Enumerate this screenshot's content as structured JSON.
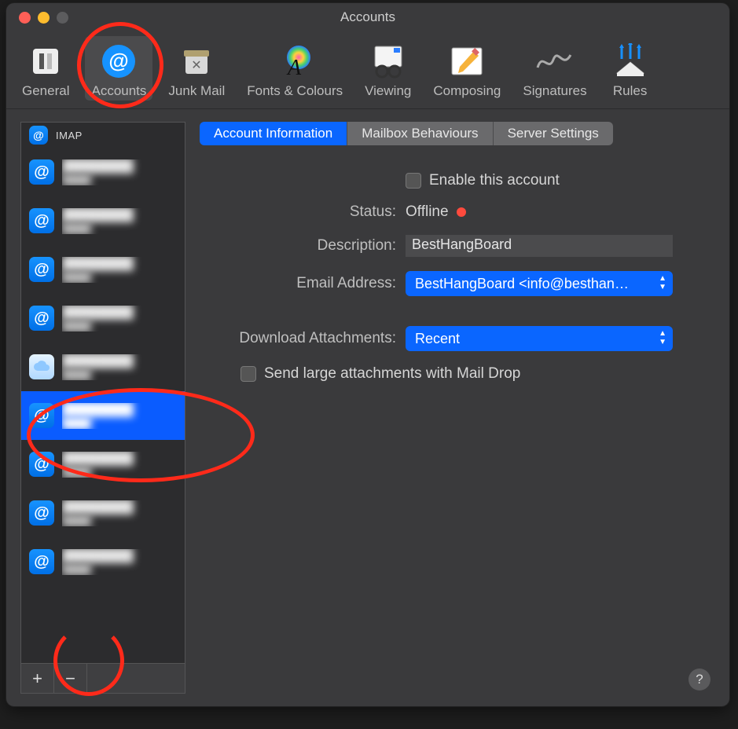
{
  "window": {
    "title": "Accounts"
  },
  "toolbar": {
    "items": [
      {
        "label": "General"
      },
      {
        "label": "Accounts"
      },
      {
        "label": "Junk Mail"
      },
      {
        "label": "Fonts & Colours"
      },
      {
        "label": "Viewing"
      },
      {
        "label": "Composing"
      },
      {
        "label": "Signatures"
      },
      {
        "label": "Rules"
      }
    ],
    "selected_index": 1
  },
  "sidebar": {
    "header_label": "IMAP",
    "add_label": "+",
    "remove_label": "−"
  },
  "tabs": {
    "items": [
      {
        "label": "Account Information"
      },
      {
        "label": "Mailbox Behaviours"
      },
      {
        "label": "Server Settings"
      }
    ],
    "active_index": 0
  },
  "form": {
    "enable_label": "Enable this account",
    "status_label": "Status:",
    "status_value": "Offline",
    "description_label": "Description:",
    "description_value": "BestHangBoard",
    "email_label": "Email Address:",
    "email_value": "BestHangBoard <info@besthan…",
    "download_label": "Download Attachments:",
    "download_value": "Recent",
    "maildrop_label": "Send large attachments with Mail Drop"
  },
  "help_label": "?"
}
